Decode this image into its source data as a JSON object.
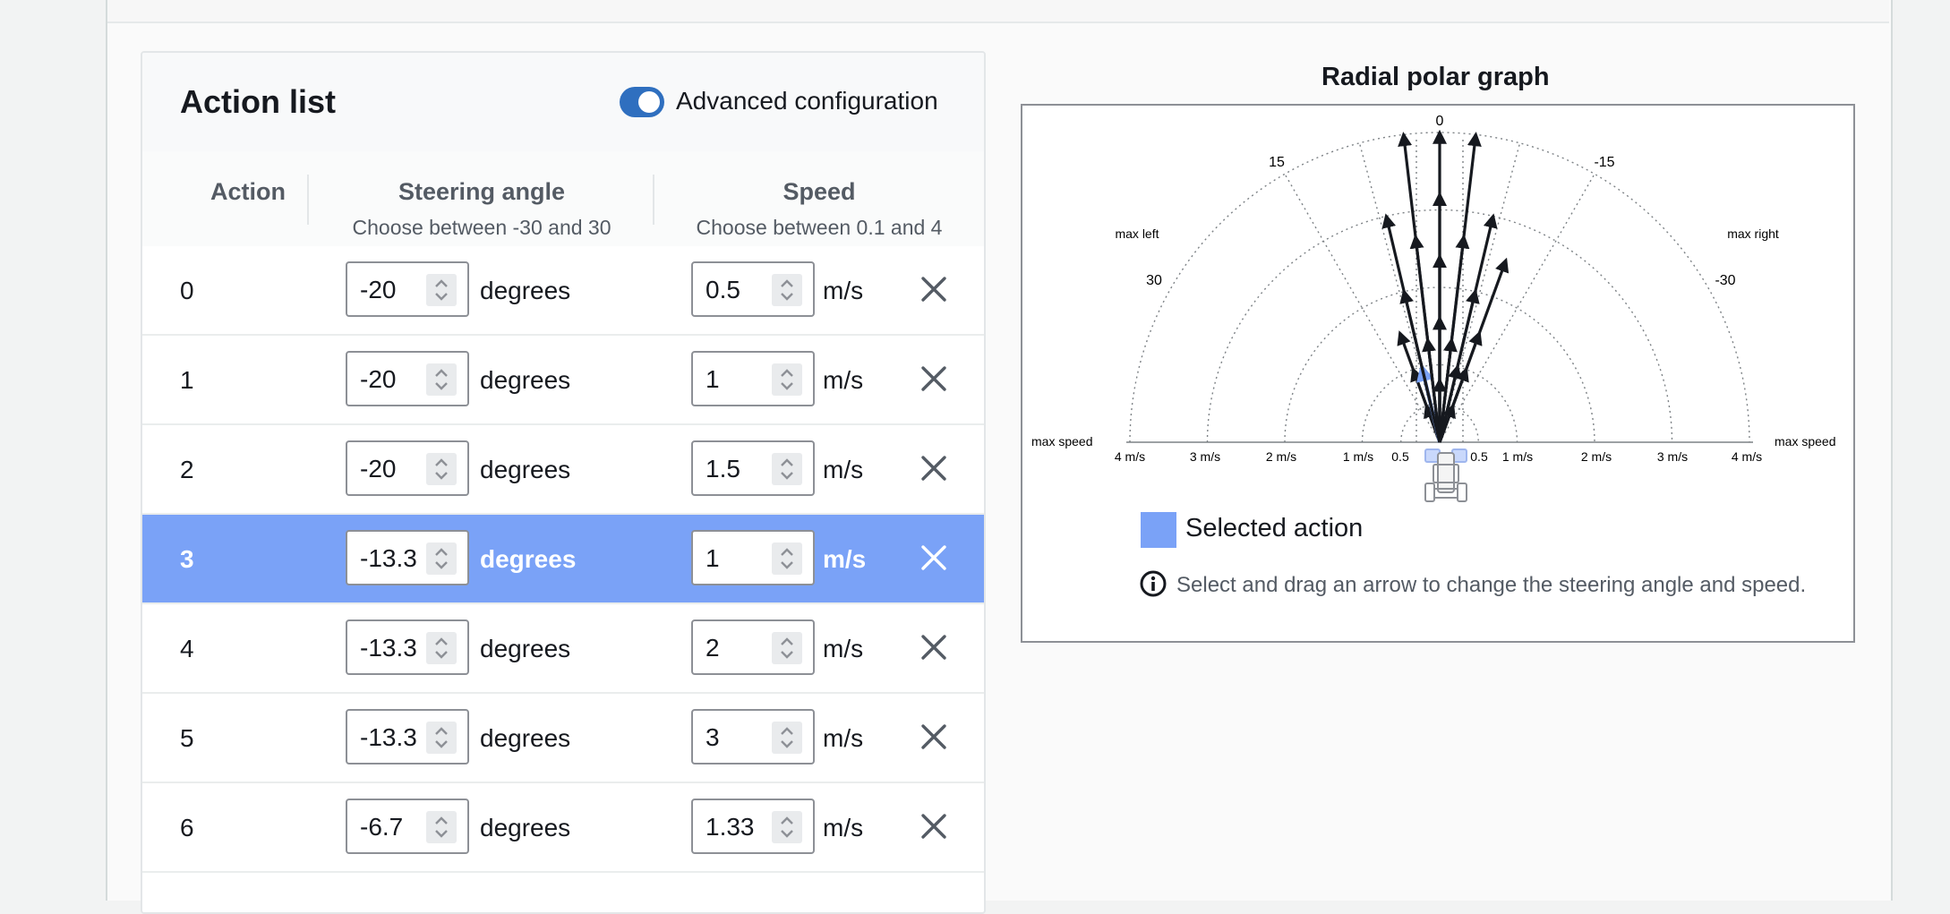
{
  "action_list": {
    "title": "Action list",
    "toggle_label": "Advanced configuration",
    "toggle_on": true,
    "columns": {
      "action": "Action",
      "steering": "Steering angle",
      "steering_hint": "Choose between -30 and 30",
      "speed": "Speed",
      "speed_hint": "Choose between 0.1 and 4"
    },
    "rows": [
      {
        "index": "0",
        "angle": "-20",
        "angle_unit": "degrees",
        "speed": "0.5",
        "speed_unit": "m/s"
      },
      {
        "index": "1",
        "angle": "-20",
        "angle_unit": "degrees",
        "speed": "1",
        "speed_unit": "m/s"
      },
      {
        "index": "2",
        "angle": "-20",
        "angle_unit": "degrees",
        "speed": "1.5",
        "speed_unit": "m/s"
      },
      {
        "index": "3",
        "angle": "-13.3",
        "angle_unit": "degrees",
        "speed": "1",
        "speed_unit": "m/s",
        "selected": true
      },
      {
        "index": "4",
        "angle": "-13.3",
        "angle_unit": "degrees",
        "speed": "2",
        "speed_unit": "m/s"
      },
      {
        "index": "5",
        "angle": "-13.3",
        "angle_unit": "degrees",
        "speed": "3",
        "speed_unit": "m/s"
      },
      {
        "index": "6",
        "angle": "-6.7",
        "angle_unit": "degrees",
        "speed": "1.33",
        "speed_unit": "m/s"
      }
    ]
  },
  "graph": {
    "title": "Radial polar graph",
    "angle_labels": {
      "a0": "0",
      "a15": "15",
      "am15": "-15",
      "a30": "30",
      "am30": "-30",
      "max_left": "max left",
      "max_right": "max right"
    },
    "speed_labels": {
      "max_speed_left": "max speed",
      "max_speed_right": "max speed",
      "l4": "4 m/s",
      "l3": "3 m/s",
      "l2": "2 m/s",
      "l1": "1 m/s",
      "l05": "0.5",
      "r05": "0.5",
      "r1": "1 m/s",
      "r2": "2 m/s",
      "r3": "3 m/s",
      "r4": "4 m/s"
    },
    "legend_label": "Selected action",
    "info_text": "Select and drag an arrow to change the steering angle and speed.",
    "colors": {
      "arrow": "#16191f",
      "selected": "#7aa2f7"
    }
  }
}
